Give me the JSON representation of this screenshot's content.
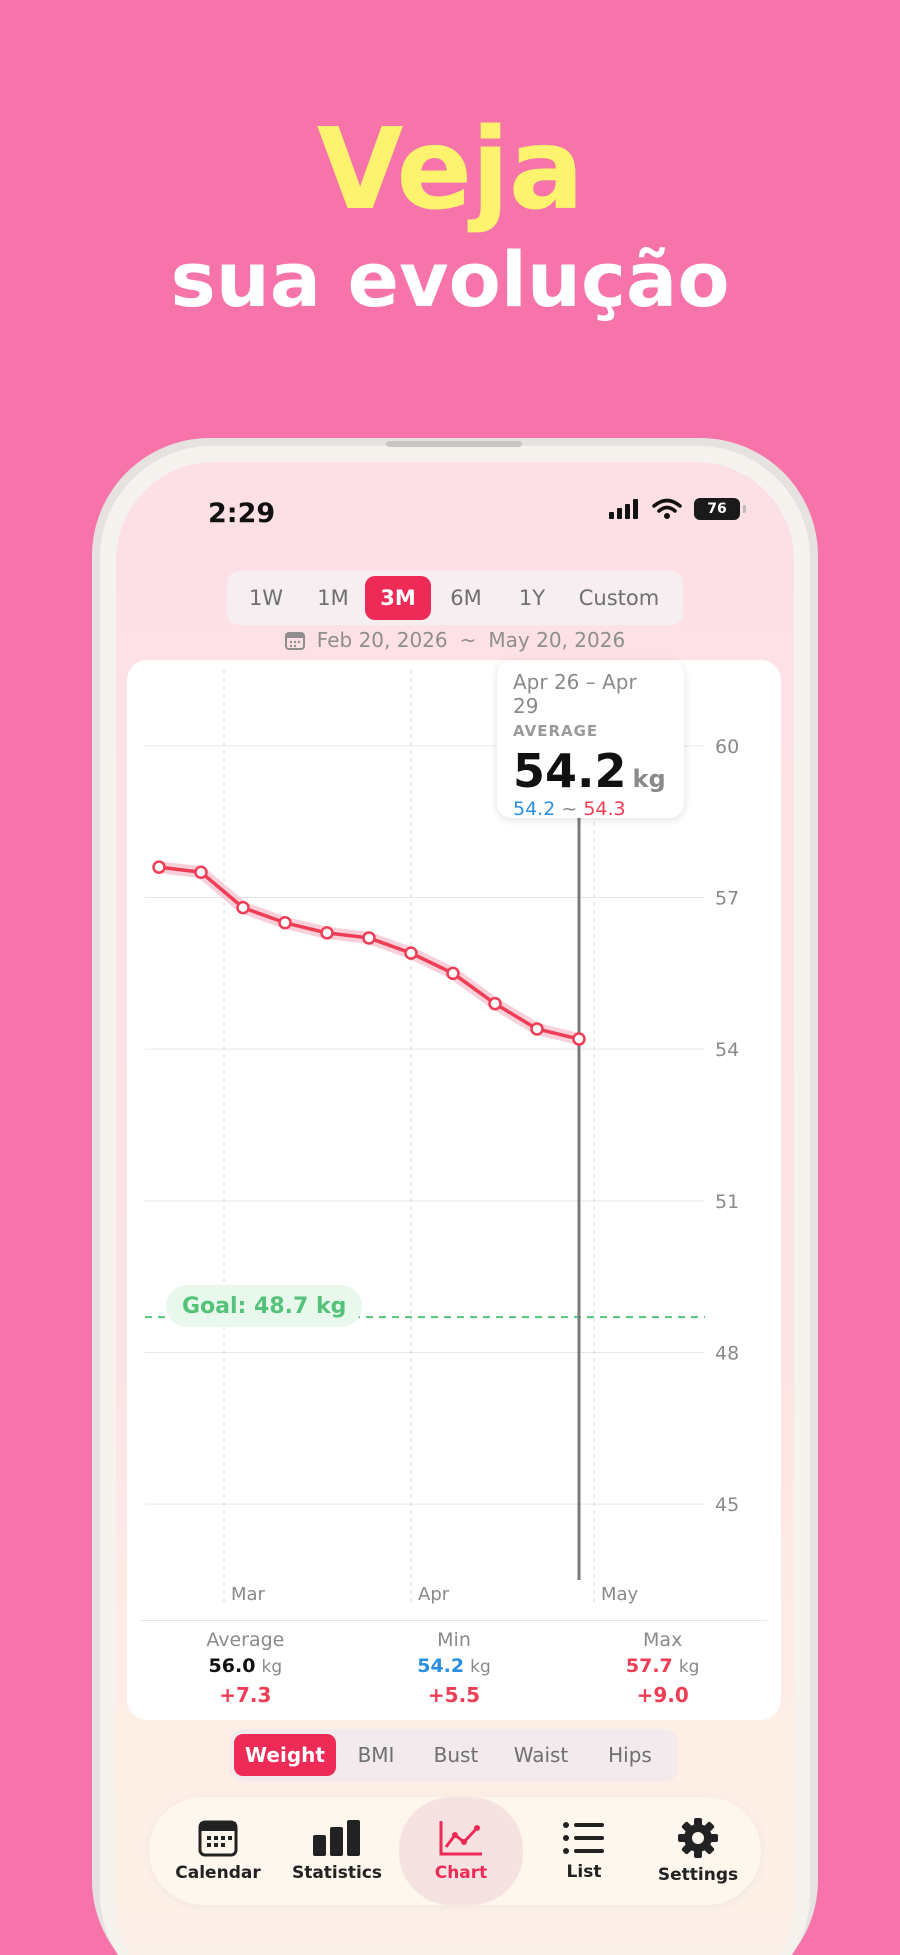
{
  "headline": {
    "line1": "Veja",
    "line2": "sua evolução"
  },
  "status": {
    "time": "2:29",
    "battery": "76"
  },
  "range_tabs": [
    {
      "label": "1W",
      "active": false
    },
    {
      "label": "1M",
      "active": false
    },
    {
      "label": "3M",
      "active": true
    },
    {
      "label": "6M",
      "active": false
    },
    {
      "label": "1Y",
      "active": false
    },
    {
      "label": "Custom",
      "active": false
    }
  ],
  "date_range": {
    "start": "Feb 20, 2026",
    "sep": "~",
    "end": "May 20, 2026"
  },
  "tooltip": {
    "range": "Apr 26 – Apr 29",
    "label": "AVERAGE",
    "value": "54.2",
    "unit": "kg",
    "min": "54.2",
    "sep": "~",
    "max": "54.3"
  },
  "goal": {
    "label": "Goal: 48.7 kg",
    "value": 48.7
  },
  "chart_data": {
    "type": "line",
    "y_ticks": [
      "60",
      "57",
      "54",
      "51",
      "48",
      "45"
    ],
    "ylim": [
      43.5,
      61.5
    ],
    "x_ticks": [
      "Mar",
      "Apr",
      "May"
    ],
    "series": [
      {
        "values": [
          57.6,
          57.5,
          56.8,
          56.5,
          56.3,
          56.2,
          55.9,
          55.5,
          54.9,
          54.4,
          54.2
        ]
      }
    ],
    "goal_line": 48.7,
    "colors": {
      "line": "#ee3d55",
      "goal": "#55c27a",
      "grid": "#e6e6e6"
    }
  },
  "stats": [
    {
      "label": "Average",
      "value": "56.0",
      "unit": "kg",
      "delta": "+7.3",
      "color": "#111111"
    },
    {
      "label": "Min",
      "value": "54.2",
      "unit": "kg",
      "delta": "+5.5",
      "color": "#2a8fe0"
    },
    {
      "label": "Max",
      "value": "57.7",
      "unit": "kg",
      "delta": "+9.0",
      "color": "#ee3d55"
    }
  ],
  "metric_tabs": [
    {
      "label": "Weight",
      "active": true
    },
    {
      "label": "BMI",
      "active": false
    },
    {
      "label": "Bust",
      "active": false
    },
    {
      "label": "Waist",
      "active": false
    },
    {
      "label": "Hips",
      "active": false
    }
  ],
  "tabbar": [
    {
      "label": "Calendar",
      "icon": "calendar-icon"
    },
    {
      "label": "Statistics",
      "icon": "bar-chart-icon"
    },
    {
      "label": "Chart",
      "icon": "line-chart-icon"
    },
    {
      "label": "List",
      "icon": "list-icon"
    },
    {
      "label": "Settings",
      "icon": "gear-icon"
    }
  ]
}
